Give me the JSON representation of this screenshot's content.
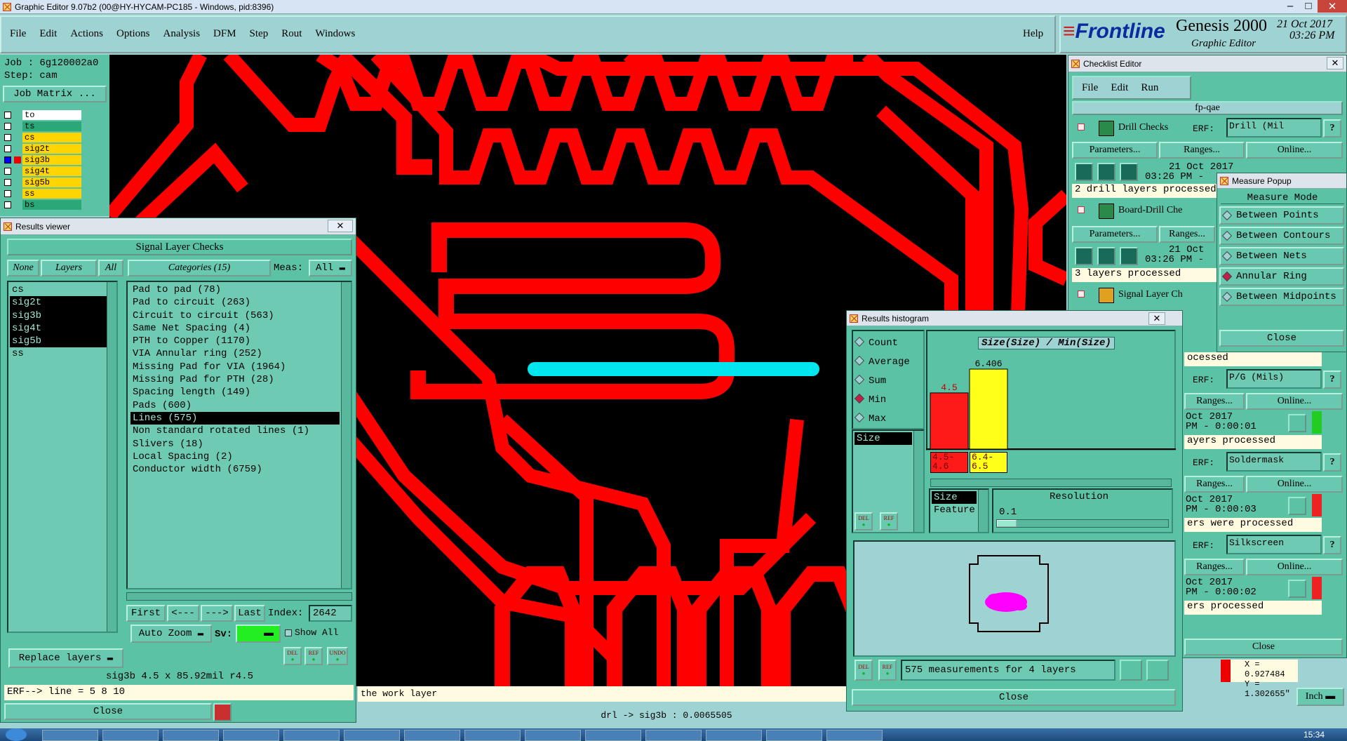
{
  "title_bar": {
    "text": "Graphic Editor 9.07b2 (00@HY-HYCAM-PC185 - Windows, pid:8396)"
  },
  "menubar": {
    "items": [
      "File",
      "Edit",
      "Actions",
      "Options",
      "Analysis",
      "DFM",
      "Step",
      "Rout",
      "Windows"
    ],
    "help": "Help"
  },
  "brand": {
    "logo": "Frontline",
    "product": "Genesis 2000",
    "subtitle": "Graphic Editor",
    "date": "21 Oct 2017",
    "time": "03:26 PM"
  },
  "job": {
    "job": "Job : 6g120002a0",
    "step": "Step: cam",
    "matrix_button": "Job Matrix ..."
  },
  "layers": [
    {
      "name": "to",
      "color": "#ffffff"
    },
    {
      "name": "ts",
      "color": "#2aa878"
    },
    {
      "name": "cs",
      "color": "#ffd400"
    },
    {
      "name": "sig2t",
      "color": "#ffd400"
    },
    {
      "name": "sig3b",
      "color": "#ffd400"
    },
    {
      "name": "sig4t",
      "color": "#ffd400"
    },
    {
      "name": "sig5b",
      "color": "#ffd400"
    },
    {
      "name": "ss",
      "color": "#ffd400"
    },
    {
      "name": "bs",
      "color": "#2aa878"
    }
  ],
  "results_viewer": {
    "title": "Results viewer",
    "header": "Signal Layer Checks",
    "none": "None",
    "layers": "Layers",
    "all": "All",
    "categories_label": "Categories (15)",
    "meas_label": "Meas:",
    "meas_value": "All",
    "layer_list": [
      "cs",
      "sig2t",
      "sig3b",
      "sig4t",
      "sig5b",
      "ss"
    ],
    "categories": [
      "Pad to pad (78)",
      "Pad to circuit (263)",
      "Circuit to circuit (563)",
      "Same Net Spacing (4)",
      "PTH to Copper (1170)",
      "VIA Annular ring (252)",
      "Missing Pad for VIA (1964)",
      "Missing Pad for PTH (28)",
      "Spacing length (149)",
      "Pads (600)",
      "Lines (575)",
      "Non standard rotated lines (1)",
      "Slivers (18)",
      "Local Spacing (2)",
      "Conductor width (6759)"
    ],
    "nav": {
      "first": "First",
      "prev": "<---",
      "next": "--->",
      "last": "Last",
      "index_label": "Index:",
      "index_value": "2642"
    },
    "auto_zoom": "Auto Zoom",
    "sv": "Sv:",
    "show_all": "Show All",
    "replace_layers": "Replace layers",
    "status": "sig3b 4.5 x 85.92mil  r4.5",
    "erf": "ERF--> line = 5 8 10",
    "close": "Close",
    "del": "DEL",
    "ref": "REF",
    "undo": "UNDO"
  },
  "bottom_status": {
    "hint": "the work layer",
    "measure": "drl -> sig3b : 0.0065505",
    "units": "Inch",
    "coord_x": "X = 0.927484",
    "coord_y": "Y = 1.302655\""
  },
  "checklist": {
    "title": "Checklist Editor",
    "menu": [
      "File",
      "Edit",
      "Run"
    ],
    "name": "fp-qae",
    "erf": "ERF:",
    "parameters": "Parameters...",
    "ranges": "Ranges...",
    "online": "Online...",
    "checks": [
      {
        "name": "Drill Checks",
        "erf_value": "Drill (Mil",
        "date": "21 Oct 2017",
        "time": "03:26 PM -",
        "status": "2 drill layers processed"
      },
      {
        "name": "Board-Drill Che",
        "date": "21 Oct",
        "time": "03:26 PM -",
        "status": "3 layers processed"
      },
      {
        "name": "Signal Layer Ch"
      }
    ],
    "rows": [
      {
        "erf_value": "P/G (Mils)",
        "date": "Oct 2017",
        "time": "PM - 0:00:01",
        "status": "ayers processed"
      },
      {
        "erf_value": "Soldermask",
        "date": "Oct 2017",
        "time": "PM - 0:00:03",
        "status": "ers were processed"
      },
      {
        "erf_value": "Silkscreen",
        "date": "Oct 2017",
        "time": "PM - 0:00:02",
        "status": "ers processed"
      }
    ],
    "partial_status": "ocessed",
    "close": "Close"
  },
  "measure_popup": {
    "title": "Measure Popup",
    "header": "Measure Mode",
    "modes": [
      "Between Points",
      "Between Contours",
      "Between Nets",
      "Annular Ring",
      "Between Midpoints"
    ],
    "selected": "Annular Ring",
    "close": "Close"
  },
  "histogram": {
    "title": "Results histogram",
    "stats": [
      "Count",
      "Average",
      "Sum",
      "Min",
      "Max"
    ],
    "selected_stat": "Min",
    "list": [
      "Size"
    ],
    "chart_title": "Size(Size) / Min(Size)",
    "bars": [
      {
        "label": "4.5",
        "range": "4.5-\n4.6",
        "value": 4.5,
        "color": "#ff1a1a"
      },
      {
        "label": "6.406",
        "range": "6.4-\n6.5",
        "value": 6.406,
        "color": "#ffff1a"
      }
    ],
    "mode_list": [
      "Size",
      "Feature"
    ],
    "resolution_label": "Resolution",
    "resolution_value": "0.1",
    "summary": "575 measurements for 4 layers",
    "close": "Close",
    "del": "DEL",
    "ref": "REF"
  },
  "taskbar": {
    "time": "15:34"
  }
}
